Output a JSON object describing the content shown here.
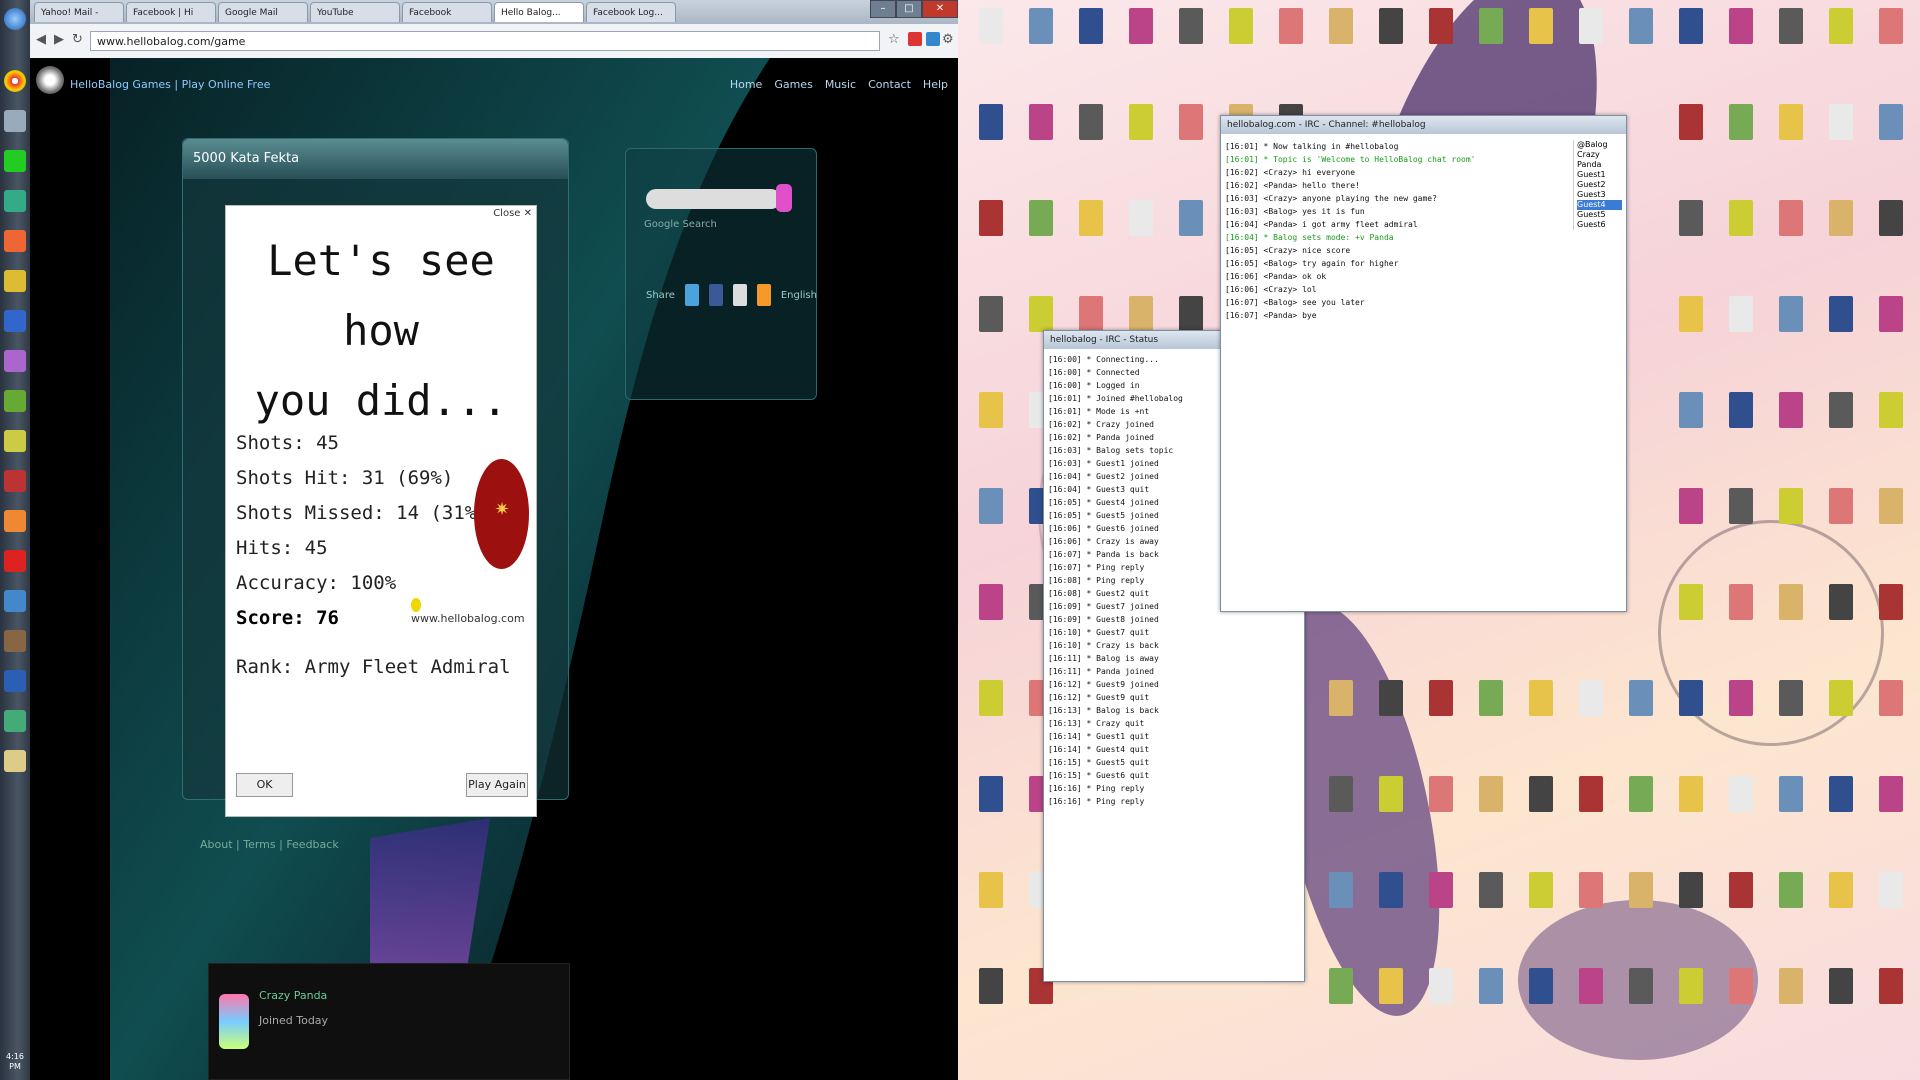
{
  "browser": {
    "tabs": [
      {
        "label": "Yahoo! Mail - "
      },
      {
        "label": "Facebook | Hi"
      },
      {
        "label": "Google Mail"
      },
      {
        "label": "YouTube"
      },
      {
        "label": "Facebook"
      },
      {
        "label": "Hello Balog...",
        "active": true
      },
      {
        "label": "Facebook Log..."
      }
    ],
    "url": "www.hellobalog.com/game",
    "win_buttons": [
      "–",
      "□",
      "✕"
    ]
  },
  "site": {
    "title": "HelloBalog Games | Play Online Free",
    "nav": [
      "Home",
      "Games",
      "Music",
      "Contact",
      "Help"
    ],
    "panel_title": "5000 Kata Fekta",
    "powered_by": "Google Search",
    "share_label": "Share",
    "share_right": "English",
    "footer": "About | Terms | Feedback",
    "chat_name": "Crazy Panda",
    "chat_sub": "Joined Today"
  },
  "dialog": {
    "title_line1": "Let's see how",
    "title_line2": "you did...",
    "close": "Close ✕",
    "stats": [
      {
        "label": "Shots",
        "value": "45"
      },
      {
        "label": "Shots Hit",
        "value": "31 (69%)"
      },
      {
        "label": "Shots Missed",
        "value": "14 (31%)"
      },
      {
        "label": "Hits",
        "value": "45"
      },
      {
        "label": "Accuracy",
        "value": "100%"
      }
    ],
    "score": "Score: 76",
    "rank_link": "www.hellobalog.com",
    "rank": "Rank: Army Fleet Admiral",
    "ok_button": "OK",
    "again_button": "Play Again"
  },
  "log_main": {
    "title": "hellobalog.com - IRC - Channel: #hellobalog",
    "lines": [
      {
        "text": "[16:01] * Now talking in #hellobalog",
        "green": false
      },
      {
        "text": "[16:01] * Topic is 'Welcome to HelloBalog chat room'",
        "green": true
      },
      {
        "text": "[16:02] <Crazy> hi everyone",
        "green": false
      },
      {
        "text": "[16:02] <Panda> hello there!",
        "green": false
      },
      {
        "text": "[16:03] <Crazy> anyone playing the new game?",
        "green": false
      },
      {
        "text": "[16:03] <Balog> yes it is fun",
        "green": false
      },
      {
        "text": "[16:04] <Panda> i got army fleet admiral",
        "green": false
      },
      {
        "text": "[16:04] * Balog sets mode: +v Panda",
        "green": true
      },
      {
        "text": "[16:05] <Crazy> nice score",
        "green": false
      },
      {
        "text": "[16:05] <Balog> try again for higher",
        "green": false
      },
      {
        "text": "[16:06] <Panda> ok ok",
        "green": false
      },
      {
        "text": "[16:06] <Crazy> lol",
        "green": false
      },
      {
        "text": "[16:07] <Balog> see you later",
        "green": false
      },
      {
        "text": "[16:07] <Panda> bye",
        "green": false
      }
    ],
    "nicks": [
      "@Balog",
      "Crazy",
      "Panda",
      "Guest1",
      "Guest2",
      "Guest3",
      "Guest4",
      "Guest5",
      "Guest6"
    ]
  },
  "log_back": {
    "title": "hellobalog - IRC - Status",
    "lines": [
      "[16:00] * Connecting...",
      "[16:00] * Connected",
      "[16:00] * Logged in",
      "[16:01] * Joined #hellobalog",
      "[16:01] * Mode is +nt",
      "[16:02] * Crazy joined",
      "[16:02] * Panda joined",
      "[16:03] * Balog sets topic",
      "[16:03] * Guest1 joined",
      "[16:04] * Guest2 joined",
      "[16:04] * Guest3 quit",
      "[16:05] * Guest4 joined",
      "[16:05] * Guest5 joined",
      "[16:06] * Guest6 joined",
      "[16:06] * Crazy is away",
      "[16:07] * Panda is back",
      "[16:07] * Ping reply",
      "[16:08] * Ping reply",
      "[16:08] * Guest2 quit",
      "[16:09] * Guest7 joined",
      "[16:09] * Guest8 joined",
      "[16:10] * Guest7 quit",
      "[16:10] * Crazy is back",
      "[16:11] * Balog is away",
      "[16:11] * Panda joined",
      "[16:12] * Guest9 joined",
      "[16:12] * Guest9 quit",
      "[16:13] * Balog is back",
      "[16:13] * Crazy quit",
      "[16:14] * Guest1 quit",
      "[16:14] * Guest4 quit",
      "[16:15] * Guest5 quit",
      "[16:15] * Guest6 quit",
      "[16:16] * Ping reply",
      "[16:16] * Ping reply"
    ]
  },
  "taskbar_clock": "4:16 PM"
}
